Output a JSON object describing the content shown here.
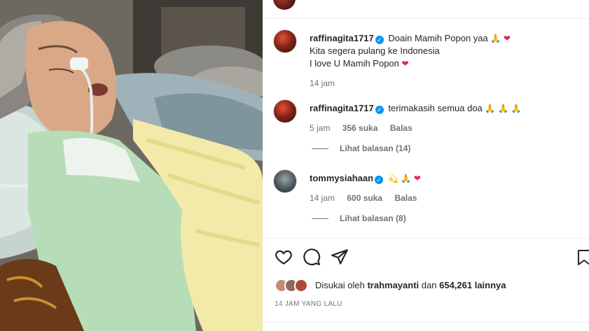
{
  "colors": {
    "text": "#262626",
    "muted": "#737373",
    "verified": "#0095f6",
    "heart": "#e0245e"
  },
  "photo": {
    "description_icon": "post-photo"
  },
  "comments": [
    {
      "username": "raffinagita1717",
      "verified": true,
      "lines": [
        "Doain Mamih Popon yaa",
        "Kita segera pulang ke Indonesia",
        "I love U Mamih Popon"
      ],
      "time": "14 jam"
    },
    {
      "username": "raffinagita1717",
      "verified": true,
      "text": "terimakasih semua doa",
      "time": "5 jam",
      "likes": "356 suka",
      "reply": "Balas",
      "view_replies": "Lihat balasan (14)"
    },
    {
      "username": "tommysiahaan",
      "verified": true,
      "text": "",
      "time": "14 jam",
      "likes": "600 suka",
      "reply": "Balas",
      "view_replies": "Lihat balasan (8)"
    }
  ],
  "icons": [
    "heart-icon",
    "comment-icon",
    "share-icon",
    "bookmark-icon"
  ],
  "likes": {
    "prefix": "Disukai oleh",
    "user": "trahmayanti",
    "middle": "dan",
    "count": "654,261 lainnya"
  },
  "timestamp": "14 JAM YANG LALU"
}
